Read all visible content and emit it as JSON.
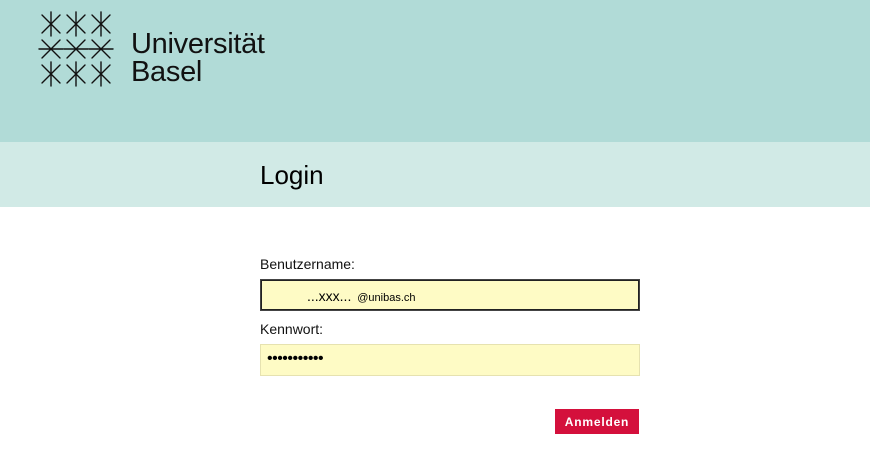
{
  "header": {
    "logo": {
      "icon": "university-star-emblem-icon",
      "line1": "Universität",
      "line2": "Basel"
    }
  },
  "page": {
    "title": "Login"
  },
  "form": {
    "username": {
      "label": "Benutzername:",
      "value_prefix": "...xxx...",
      "value_domain": "@unibas.ch"
    },
    "password": {
      "label": "Kennwort:",
      "masked_value": "•••••••••••"
    },
    "submit_label": "Anmelden"
  },
  "colors": {
    "header_bg": "#b1dbd7",
    "titlebar_bg": "#d1eae6",
    "input_bg": "#fefbc5",
    "button_bg": "#d4103c"
  }
}
